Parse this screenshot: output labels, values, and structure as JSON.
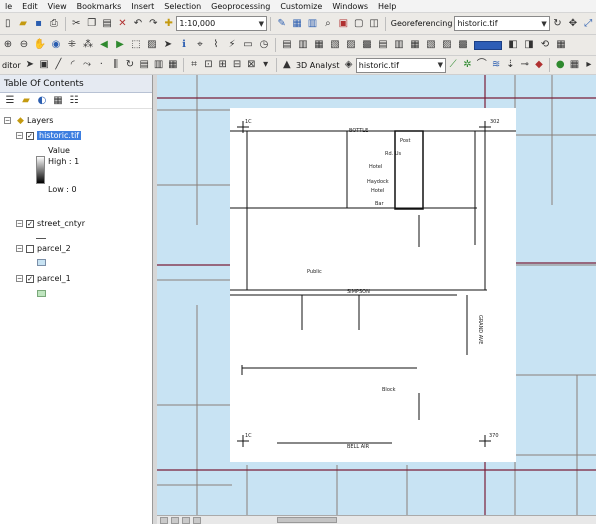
{
  "menubar": {
    "items": [
      "le",
      "Edit",
      "View",
      "Bookmarks",
      "Insert",
      "Selection",
      "Geoprocessing",
      "Customize",
      "Windows",
      "Help"
    ]
  },
  "toolbar1": {
    "scale": "1:10,000",
    "georef_label": "Georeferencing",
    "georef_layer": "historic.tif"
  },
  "toolbar3": {
    "left_label": "ditor",
    "analyst_label": "3D Analyst",
    "layer": "historic.tif"
  },
  "toc": {
    "title": "Table Of Contents",
    "layers_label": "Layers",
    "layers": [
      {
        "name": "historic.tif",
        "checked": true,
        "selected": true,
        "legend": {
          "title": "Value",
          "high": "High : 1",
          "low": "Low : 0"
        }
      },
      {
        "name": "street_cntyr",
        "checked": true
      },
      {
        "name": "parcel_2",
        "checked": false
      },
      {
        "name": "parcel_1",
        "checked": true
      }
    ]
  },
  "map": {
    "scan_labels": {
      "top_street": "BOTTLE",
      "mid_street": "SIMPSON",
      "bottom_street": "BELL AIR",
      "box_line1": "Post",
      "box_line2": "Rd. Us",
      "box_line3": "Hotel",
      "box_line4": "Haydock",
      "box_line5": "Hotel",
      "box_line6": "Bar",
      "lower_label": "Block",
      "left_label": "Public",
      "side_label": "GRAND AVE",
      "corner_tl": "1C",
      "corner_tr": "302",
      "corner_bl": "1C",
      "corner_br": "370"
    },
    "colors": {
      "water": "#c8e3f3",
      "parcel_line": "#8a7f78",
      "road": "#7a1e38"
    }
  }
}
